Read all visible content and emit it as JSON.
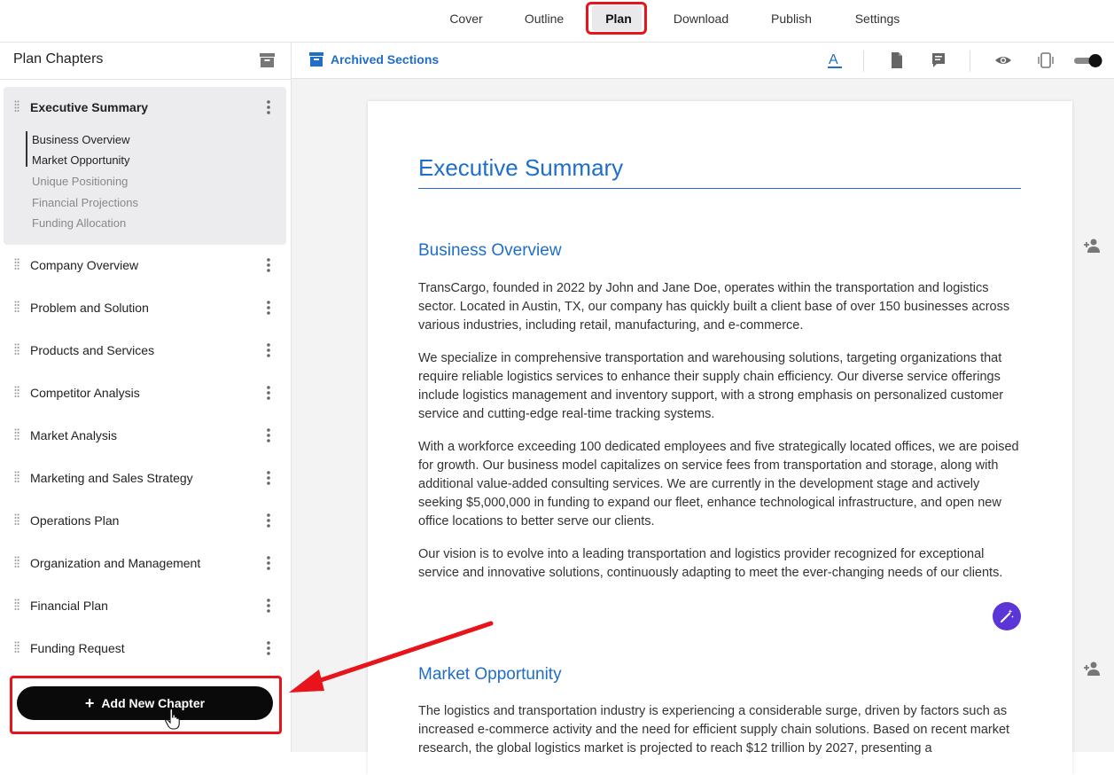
{
  "topnav": {
    "tabs": [
      {
        "label": "Cover"
      },
      {
        "label": "Outline"
      },
      {
        "label": "Plan"
      },
      {
        "label": "Download"
      },
      {
        "label": "Publish"
      },
      {
        "label": "Settings"
      }
    ],
    "active_tab": "Plan"
  },
  "sidebar": {
    "title": "Plan Chapters",
    "active_chapter": {
      "label": "Executive Summary",
      "sections": [
        {
          "label": "Business Overview"
        },
        {
          "label": "Market Opportunity"
        },
        {
          "label": "Unique Positioning"
        },
        {
          "label": "Financial Projections"
        },
        {
          "label": "Funding Allocation"
        }
      ]
    },
    "chapters": [
      {
        "label": "Company Overview"
      },
      {
        "label": "Problem and Solution"
      },
      {
        "label": "Products and Services"
      },
      {
        "label": "Competitor Analysis"
      },
      {
        "label": "Market Analysis"
      },
      {
        "label": "Marketing and Sales Strategy"
      },
      {
        "label": "Operations Plan"
      },
      {
        "label": "Organization and Management"
      },
      {
        "label": "Financial Plan"
      },
      {
        "label": "Funding Request"
      }
    ],
    "add_button_label": "Add New Chapter"
  },
  "toolbar": {
    "archived_label": "Archived Sections",
    "icons": [
      "text-color-icon",
      "document-icon",
      "comment-icon",
      "eye-icon",
      "device-icon",
      "toggle-switch"
    ]
  },
  "document": {
    "title": "Executive Summary",
    "sections": [
      {
        "heading": "Business Overview",
        "paragraphs": [
          "TransCargo, founded in 2022 by John and Jane Doe, operates within the transportation and logistics sector. Located in Austin, TX, our company has quickly built a client base of over 150 businesses across various industries, including retail, manufacturing, and e-commerce.",
          "We specialize in comprehensive transportation and warehousing solutions, targeting organizations that require reliable logistics services to enhance their supply chain efficiency. Our diverse service offerings include logistics management and inventory support, with a strong emphasis on personalized customer service and cutting-edge real-time tracking systems.",
          "With a workforce exceeding 100 dedicated employees and five strategically located offices, we are poised for growth. Our business model capitalizes on service fees from transportation and storage, along with additional value-added consulting services. We are currently in the development stage and actively seeking $5,000,000 in funding to expand our fleet, enhance technological infrastructure, and open new office locations to better serve our clients.",
          "Our vision is to evolve into a leading transportation and logistics provider recognized for exceptional service and innovative solutions, continuously adapting to meet the ever-changing needs of our clients."
        ]
      },
      {
        "heading": "Market Opportunity",
        "paragraphs": [
          "The logistics and transportation industry is experiencing a considerable surge, driven by factors such as increased e-commerce activity and the need for efficient supply chain solutions. Based on recent market research, the global logistics market is projected to reach $12 trillion by 2027, presenting a"
        ]
      }
    ]
  },
  "colors": {
    "accent_blue": "#1f6ec7",
    "highlight_red": "#e8141c",
    "magic_purple": "#5b35d5"
  }
}
